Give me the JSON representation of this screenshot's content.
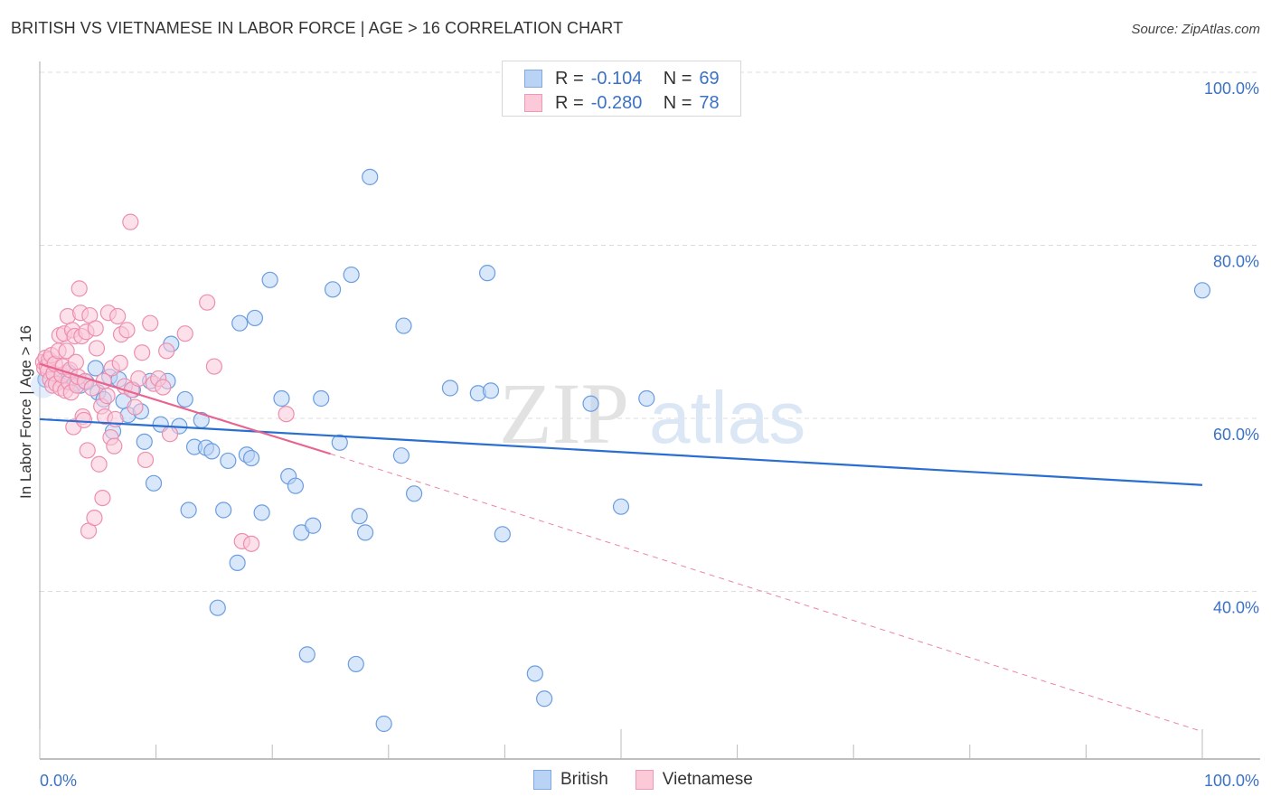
{
  "header": {
    "title": "BRITISH VS VIETNAMESE IN LABOR FORCE | AGE > 16 CORRELATION CHART",
    "source": "Source: ZipAtlas.com"
  },
  "legend": {
    "rows": [
      {
        "r_label": "R =",
        "r_value": "-0.104",
        "n_label": "N =",
        "n_value": "69",
        "series": "British"
      },
      {
        "r_label": "R =",
        "r_value": "-0.280",
        "n_label": "N =",
        "n_value": "78",
        "series": "Vietnamese"
      }
    ]
  },
  "watermark": {
    "zip": "ZIP",
    "atlas": "atlas"
  },
  "colors": {
    "british_fill": "#b9d3f5",
    "british_stroke": "#6b9de0",
    "british_line": "#2a6fd0",
    "vietnamese_fill": "#fbc9d8",
    "vietnamese_stroke": "#ec8fae",
    "vietnamese_line": "#e8648f",
    "tick_text": "#3b72c4"
  },
  "chart_data": {
    "type": "scatter",
    "title": "BRITISH VS VIETNAMESE IN LABOR FORCE | AGE > 16 CORRELATION CHART",
    "xlabel": "",
    "ylabel": "In Labor Force | Age > 16",
    "xlim": [
      0,
      100
    ],
    "ylim": [
      22,
      104
    ],
    "x_tick_labels": [
      "0.0%",
      "100.0%"
    ],
    "y_ticks": [
      40,
      60,
      80,
      100
    ],
    "y_tick_labels": [
      "40.0%",
      "60.0%",
      "80.0%",
      "100.0%"
    ],
    "grid": true,
    "legend_position": "top-center",
    "series": [
      {
        "name": "British",
        "r": -0.104,
        "n": 69,
        "trend": {
          "x": [
            0,
            100
          ],
          "y": [
            59.9,
            52.3
          ],
          "style": "solid"
        },
        "points": [
          [
            0.5,
            64.5
          ],
          [
            1.5,
            65.0
          ],
          [
            2.0,
            64.3
          ],
          [
            2.5,
            65.3
          ],
          [
            3.0,
            64.0
          ],
          [
            3.5,
            63.8
          ],
          [
            4.0,
            64.2
          ],
          [
            4.8,
            65.8
          ],
          [
            5.0,
            63.0
          ],
          [
            5.5,
            62.2
          ],
          [
            6.0,
            64.8
          ],
          [
            6.3,
            58.5
          ],
          [
            6.8,
            64.5
          ],
          [
            7.2,
            62.0
          ],
          [
            7.6,
            60.4
          ],
          [
            8.0,
            63.3
          ],
          [
            8.7,
            60.8
          ],
          [
            9.0,
            57.3
          ],
          [
            9.5,
            64.3
          ],
          [
            9.8,
            52.5
          ],
          [
            10.4,
            59.3
          ],
          [
            11.0,
            64.3
          ],
          [
            11.3,
            68.6
          ],
          [
            12.0,
            59.1
          ],
          [
            12.5,
            62.2
          ],
          [
            12.8,
            49.4
          ],
          [
            13.3,
            56.7
          ],
          [
            13.9,
            59.8
          ],
          [
            14.3,
            56.6
          ],
          [
            14.8,
            56.2
          ],
          [
            15.3,
            38.1
          ],
          [
            15.8,
            49.4
          ],
          [
            16.2,
            55.1
          ],
          [
            17.2,
            71.0
          ],
          [
            17.0,
            43.3
          ],
          [
            17.8,
            55.8
          ],
          [
            18.2,
            55.4
          ],
          [
            18.5,
            71.6
          ],
          [
            19.1,
            49.1
          ],
          [
            19.8,
            76.0
          ],
          [
            20.8,
            62.3
          ],
          [
            21.4,
            53.3
          ],
          [
            22.0,
            52.2
          ],
          [
            22.5,
            46.8
          ],
          [
            23.0,
            32.7
          ],
          [
            23.5,
            47.6
          ],
          [
            24.2,
            62.3
          ],
          [
            25.2,
            74.9
          ],
          [
            25.8,
            57.2
          ],
          [
            26.8,
            76.6
          ],
          [
            27.2,
            31.6
          ],
          [
            27.5,
            48.7
          ],
          [
            28.0,
            46.8
          ],
          [
            28.4,
            87.9
          ],
          [
            29.6,
            24.7
          ],
          [
            31.1,
            55.7
          ],
          [
            31.3,
            70.7
          ],
          [
            32.2,
            51.3
          ],
          [
            35.3,
            63.5
          ],
          [
            37.7,
            62.9
          ],
          [
            38.5,
            76.8
          ],
          [
            38.8,
            63.2
          ],
          [
            39.8,
            46.6
          ],
          [
            42.6,
            30.5
          ],
          [
            43.4,
            27.6
          ],
          [
            47.4,
            61.7
          ],
          [
            50.0,
            49.8
          ],
          [
            52.2,
            62.3
          ],
          [
            100.0,
            74.8
          ]
        ]
      },
      {
        "name": "Vietnamese",
        "r": -0.28,
        "n": 78,
        "trend": {
          "x": [
            0,
            25,
            100
          ],
          "y": [
            66.3,
            55.9,
            23.8
          ],
          "style": "solid-then-dashed",
          "solid_until": 25
        },
        "points": [
          [
            0.3,
            66.5
          ],
          [
            0.4,
            65.8
          ],
          [
            0.5,
            67.0
          ],
          [
            0.6,
            66.0
          ],
          [
            0.7,
            65.5
          ],
          [
            0.8,
            66.8
          ],
          [
            0.9,
            64.5
          ],
          [
            1.0,
            67.3
          ],
          [
            1.1,
            63.8
          ],
          [
            1.2,
            65.2
          ],
          [
            1.3,
            66.3
          ],
          [
            1.4,
            64.0
          ],
          [
            1.6,
            67.8
          ],
          [
            1.7,
            69.6
          ],
          [
            1.8,
            63.5
          ],
          [
            1.9,
            65.0
          ],
          [
            2.0,
            66.0
          ],
          [
            2.1,
            69.8
          ],
          [
            2.2,
            63.2
          ],
          [
            2.3,
            67.8
          ],
          [
            2.4,
            71.8
          ],
          [
            2.5,
            64.2
          ],
          [
            2.6,
            65.6
          ],
          [
            2.7,
            63.0
          ],
          [
            2.8,
            70.2
          ],
          [
            2.9,
            59.0
          ],
          [
            3.0,
            69.5
          ],
          [
            3.1,
            66.5
          ],
          [
            3.2,
            63.8
          ],
          [
            3.3,
            64.8
          ],
          [
            3.4,
            75.0
          ],
          [
            3.5,
            72.2
          ],
          [
            3.6,
            69.5
          ],
          [
            3.7,
            60.2
          ],
          [
            3.8,
            59.8
          ],
          [
            3.9,
            64.3
          ],
          [
            4.0,
            70.0
          ],
          [
            4.1,
            56.3
          ],
          [
            4.2,
            47.0
          ],
          [
            4.3,
            71.9
          ],
          [
            4.5,
            63.5
          ],
          [
            4.7,
            48.5
          ],
          [
            4.8,
            70.4
          ],
          [
            4.9,
            68.1
          ],
          [
            5.1,
            54.7
          ],
          [
            5.3,
            61.4
          ],
          [
            5.4,
            50.8
          ],
          [
            5.5,
            64.3
          ],
          [
            5.6,
            60.2
          ],
          [
            5.8,
            62.6
          ],
          [
            5.9,
            72.2
          ],
          [
            6.1,
            57.8
          ],
          [
            6.2,
            65.8
          ],
          [
            6.4,
            56.8
          ],
          [
            6.5,
            59.9
          ],
          [
            6.7,
            71.8
          ],
          [
            6.9,
            66.4
          ],
          [
            7.0,
            69.7
          ],
          [
            7.3,
            63.7
          ],
          [
            7.8,
            82.7
          ],
          [
            7.5,
            70.2
          ],
          [
            7.9,
            63.3
          ],
          [
            8.2,
            61.3
          ],
          [
            8.5,
            64.6
          ],
          [
            8.8,
            67.6
          ],
          [
            9.1,
            55.2
          ],
          [
            9.5,
            71.0
          ],
          [
            9.8,
            64.0
          ],
          [
            10.2,
            64.6
          ],
          [
            10.6,
            63.6
          ],
          [
            10.9,
            67.8
          ],
          [
            11.2,
            58.2
          ],
          [
            12.5,
            69.8
          ],
          [
            14.4,
            73.4
          ],
          [
            17.4,
            45.8
          ],
          [
            18.2,
            45.5
          ],
          [
            21.2,
            60.5
          ],
          [
            15.0,
            66.0
          ]
        ]
      }
    ]
  }
}
